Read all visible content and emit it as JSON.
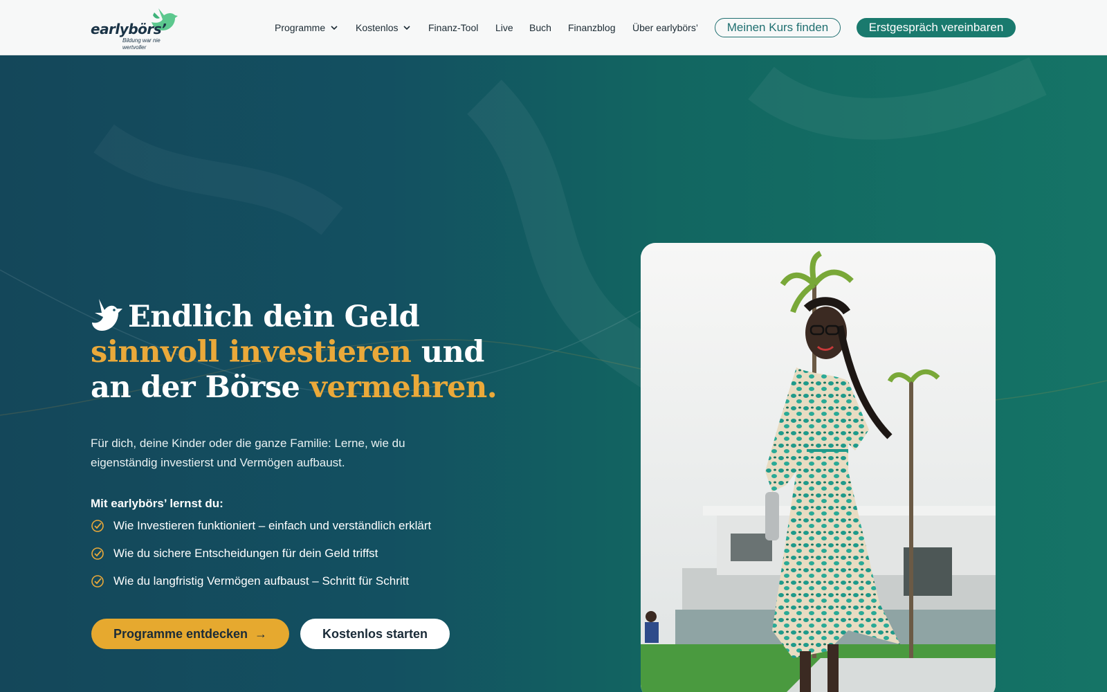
{
  "brand": {
    "wordmark": "earlybörs’",
    "tagline": "Bildung war nie wertvoller",
    "colors": {
      "teal": "#1a7a6e",
      "gold": "#eaa93a",
      "navy": "#1a3346"
    }
  },
  "nav": {
    "items": [
      {
        "label": "Programme",
        "dropdown": true
      },
      {
        "label": "Kostenlos",
        "dropdown": true
      },
      {
        "label": "Finanz-Tool"
      },
      {
        "label": "Live"
      },
      {
        "label": "Buch"
      },
      {
        "label": "Finanzblog"
      },
      {
        "label": "Über earlybörs’"
      }
    ],
    "cta_outline": "Meinen Kurs finden",
    "cta_solid": "Erstgespräch vereinbaren"
  },
  "hero": {
    "headline_part1": "Endlich dein Geld ",
    "headline_accent1": "sinnvoll investieren",
    "headline_part2": " und an der Börse ",
    "headline_accent2": "vermehren.",
    "subtitle": "Für dich, deine Kinder oder die ganze Familie: Lerne, wie du eigenständig investierst und Vermögen aufbaust.",
    "learn_title": "Mit earlybörs’ lernst du:",
    "bullets": [
      "Wie Investieren funktioniert – einfach und verständlich erklärt",
      "Wie du sichere Entscheidungen für dein Geld triffst",
      "Wie du langfristig Vermögen aufbaust – Schritt für Schritt"
    ],
    "primary_button": "Programme entdecken",
    "primary_button_icon": "arrow-right-icon",
    "secondary_button": "Kostenlos starten"
  }
}
